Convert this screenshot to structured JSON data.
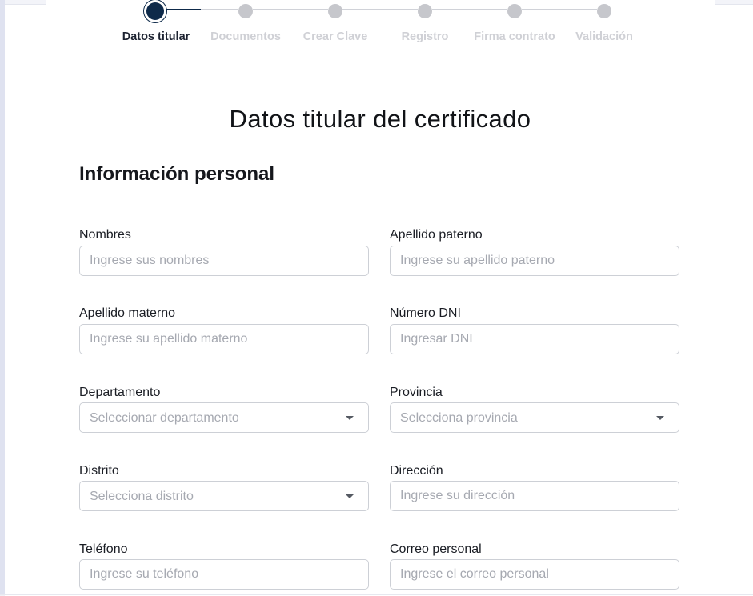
{
  "stepper": {
    "steps": [
      {
        "label": "Datos titular",
        "state": "active"
      },
      {
        "label": "Documentos",
        "state": "pending"
      },
      {
        "label": "Crear Clave",
        "state": "pending"
      },
      {
        "label": "Registro",
        "state": "pending"
      },
      {
        "label": "Firma contrato",
        "state": "pending"
      },
      {
        "label": "Validación",
        "state": "pending"
      }
    ]
  },
  "page": {
    "title": "Datos titular del certificado",
    "section_title": "Información personal"
  },
  "form": {
    "nombres": {
      "label": "Nombres",
      "placeholder": "Ingrese sus nombres",
      "value": ""
    },
    "apellido_paterno": {
      "label": "Apellido paterno",
      "placeholder": "Ingrese su apellido paterno",
      "value": ""
    },
    "apellido_materno": {
      "label": "Apellido materno",
      "placeholder": "Ingrese su apellido materno",
      "value": ""
    },
    "dni": {
      "label": "Número DNI",
      "placeholder": "Ingresar DNI",
      "value": ""
    },
    "departamento": {
      "label": "Departamento",
      "selected": "Seleccionar departamento"
    },
    "provincia": {
      "label": "Provincia",
      "selected": "Selecciona provincia"
    },
    "distrito": {
      "label": "Distrito",
      "selected": "Selecciona distrito"
    },
    "direccion": {
      "label": "Dirección",
      "placeholder": "Ingrese su dirección",
      "value": ""
    },
    "telefono": {
      "label": "Teléfono",
      "placeholder": "Ingrese su teléfono",
      "value": ""
    },
    "correo": {
      "label": "Correo personal",
      "placeholder": "Ingrese el correo personal",
      "value": ""
    }
  },
  "colors": {
    "accent": "#0e2a4a",
    "pending_step": "#c6c7cc",
    "placeholder": "#a6a9b1",
    "border": "#cdd0d6"
  }
}
